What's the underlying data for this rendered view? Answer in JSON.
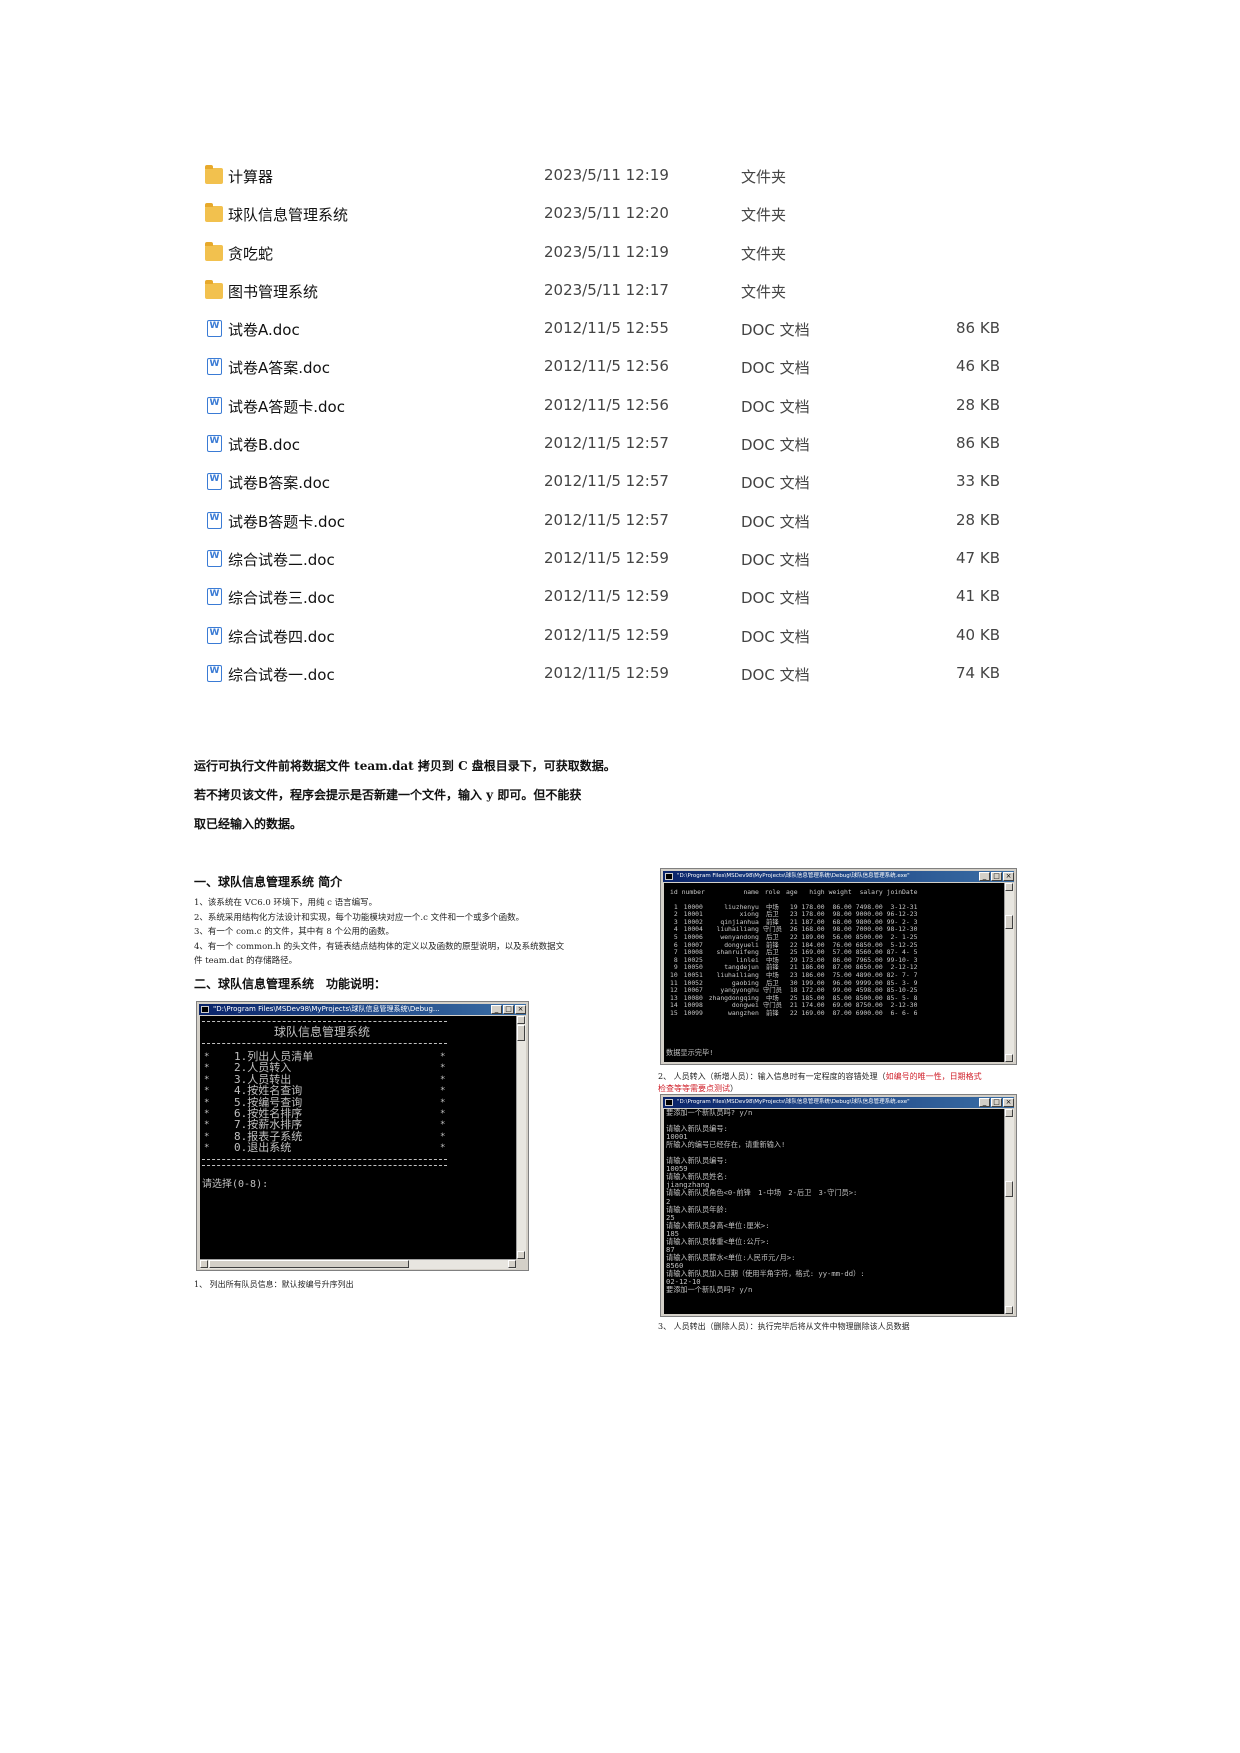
{
  "files": [
    {
      "name": "计算器",
      "date": "2023/5/11 12:19",
      "type": "文件夹",
      "size": "",
      "icon": "folder-icon"
    },
    {
      "name": "球队信息管理系统",
      "date": "2023/5/11 12:20",
      "type": "文件夹",
      "size": "",
      "icon": "folder-icon"
    },
    {
      "name": "贪吃蛇",
      "date": "2023/5/11 12:19",
      "type": "文件夹",
      "size": "",
      "icon": "folder-icon"
    },
    {
      "name": "图书管理系统",
      "date": "2023/5/11 12:17",
      "type": "文件夹",
      "size": "",
      "icon": "folder-icon"
    },
    {
      "name": "试卷A.doc",
      "date": "2012/11/5 12:55",
      "type": "DOC 文档",
      "size": "86 KB",
      "icon": "doc-icon"
    },
    {
      "name": "试卷A答案.doc",
      "date": "2012/11/5 12:56",
      "type": "DOC 文档",
      "size": "46 KB",
      "icon": "doc-icon"
    },
    {
      "name": "试卷A答题卡.doc",
      "date": "2012/11/5 12:56",
      "type": "DOC 文档",
      "size": "28 KB",
      "icon": "doc-icon"
    },
    {
      "name": "试卷B.doc",
      "date": "2012/11/5 12:57",
      "type": "DOC 文档",
      "size": "86 KB",
      "icon": "doc-icon"
    },
    {
      "name": "试卷B答案.doc",
      "date": "2012/11/5 12:57",
      "type": "DOC 文档",
      "size": "33 KB",
      "icon": "doc-icon"
    },
    {
      "name": "试卷B答题卡.doc",
      "date": "2012/11/5 12:57",
      "type": "DOC 文档",
      "size": "28 KB",
      "icon": "doc-icon"
    },
    {
      "name": "综合试卷二.doc",
      "date": "2012/11/5 12:59",
      "type": "DOC 文档",
      "size": "47 KB",
      "icon": "doc-icon"
    },
    {
      "name": "综合试卷三.doc",
      "date": "2012/11/5 12:59",
      "type": "DOC 文档",
      "size": "41 KB",
      "icon": "doc-icon"
    },
    {
      "name": "综合试卷四.doc",
      "date": "2012/11/5 12:59",
      "type": "DOC 文档",
      "size": "40 KB",
      "icon": "doc-icon"
    },
    {
      "name": "综合试卷一.doc",
      "date": "2012/11/5 12:59",
      "type": "DOC 文档",
      "size": "74 KB",
      "icon": "doc-icon"
    }
  ],
  "notes": [
    "运行可执行文件前将数据文件 team.dat 拷贝到 C 盘根目录下，可获取数据。",
    "若不拷贝该文件，程序会提示是否新建一个文件，输入 y 即可。但不能获",
    "取已经输入的数据。"
  ],
  "section1_title": "一、球队信息管理系统 简介",
  "section1_items": [
    "1、该系统在 VC6.0 环境下，用纯 c 语言编写。",
    "2、系统采用结构化方法设计和实现，每个功能模块对应一个.c 文件和一个或多个函数。",
    "3、有一个 com.c 的文件，其中有 8 个公用的函数。",
    "4、有一个 common.h 的头文件，有链表结点结构体的定义以及函数的原型说明，以及系统数据文",
    "件 team.dat 的存储路径。"
  ],
  "section2_title": "二、球队信息管理系统　功能说明：",
  "menu_window": {
    "title": "\"D:\\Program Files\\MSDev98\\MyProjects\\球队信息管理系统\\Debug...",
    "heading": "球队信息管理系统",
    "items": [
      "1.列出人员清单",
      "2.人员转入",
      "3.人员转出",
      "4.按姓名查询",
      "5.按编号查询",
      "6.按姓名排序",
      "7.按薪水排序",
      "8.报表子系统",
      "0.退出系统"
    ],
    "prompt": "请选择(0-8):"
  },
  "caption1": "1、 列出所有队员信息：默认按编号升序列出",
  "table_window": {
    "title": "\"D:\\Program Files\\MSDev98\\MyProjects\\球队信息管理系统\\Debug\\球队信息管理系统.exe\"",
    "headers": [
      "id",
      "number",
      "name",
      "role",
      "age",
      "high",
      "weight",
      "salary",
      "joinDate"
    ],
    "rows": [
      [
        "1",
        "10000",
        "liuzhenyu",
        "中场",
        "19",
        "178.00",
        "86.00",
        "7498.00",
        "3-12-31"
      ],
      [
        "2",
        "10001",
        "xiong",
        "后卫",
        "23",
        "178.00",
        "98.00",
        "9000.00",
        "96-12-23"
      ],
      [
        "3",
        "10002",
        "qinjianhua",
        "前锋",
        "21",
        "187.00",
        "68.00",
        "9800.00",
        "99- 2- 3"
      ],
      [
        "4",
        "10004",
        "liuhailiang",
        "守门员",
        "26",
        "168.00",
        "98.00",
        "7000.00",
        "98-12-30"
      ],
      [
        "5",
        "10006",
        "wenyandong",
        "后卫",
        "22",
        "189.00",
        "56.00",
        "8500.00",
        "2- 1-25"
      ],
      [
        "6",
        "10007",
        "dongyueli",
        "前锋",
        "22",
        "184.00",
        "76.00",
        "6850.00",
        "5-12-25"
      ],
      [
        "7",
        "10008",
        "shanruifeng",
        "后卫",
        "25",
        "169.00",
        "57.00",
        "8560.00",
        "87- 4- 5"
      ],
      [
        "8",
        "10025",
        "linlei",
        "中场",
        "29",
        "173.00",
        "86.00",
        "7965.00",
        "99-10- 3"
      ],
      [
        "9",
        "10050",
        "tangdejun",
        "前锋",
        "21",
        "186.00",
        "87.00",
        "8650.00",
        "2-12-12"
      ],
      [
        "10",
        "10051",
        "liuhailiang",
        "中场",
        "23",
        "186.00",
        "75.00",
        "4890.00",
        "82- 7- 7"
      ],
      [
        "11",
        "10052",
        "gaobing",
        "后卫",
        "30",
        "199.00",
        "96.00",
        "9999.00",
        "85- 3- 9"
      ],
      [
        "12",
        "10067",
        "yangyonghu",
        "守门员",
        "18",
        "172.00",
        "99.00",
        "4598.00",
        "85-10-25"
      ],
      [
        "13",
        "10080",
        "zhangdongqing",
        "中场",
        "25",
        "185.00",
        "85.00",
        "8500.00",
        "85- 5- 8"
      ],
      [
        "14",
        "10098",
        "dongwei",
        "守门员",
        "21",
        "174.00",
        "69.00",
        "8750.00",
        "2-12-30"
      ],
      [
        "15",
        "10099",
        "wangzhen",
        "前锋",
        "22",
        "169.00",
        "87.00",
        "6900.00",
        "6- 6- 6"
      ]
    ],
    "footer": "数据显示完毕!"
  },
  "caption2_prefix": "2、 人员转入（新增人员）：输入信息时有一定程度的容错处理（",
  "caption2_red": "如编号的唯一性，日期格式检查等等需要点测试",
  "caption2_suffix": "）",
  "input_window": {
    "title": "\"D:\\Program Files\\MSDev98\\MyProjects\\球队信息管理系统\\Debug\\球队信息管理系统.exe\"",
    "lines": [
      "要添加一个新队员吗? y/n",
      "",
      "请输入新队员编号:",
      "10001",
      "所输入的编号已经存在，请重新输入!",
      "",
      "请输入新队员编号:",
      "10059",
      "请输入新队员姓名:",
      "jiangzhang",
      "请输入新队员角色<0-前锋　1-中场　2-后卫　3-守门员>:",
      "2",
      "请输入新队员年龄:",
      "25",
      "请输入新队员身高<单位:厘米>:",
      "185",
      "请输入新队员体重<单位:公斤>:",
      "87",
      "请输入新队员薪水<单位:人民币元/月>:",
      "8560",
      "请输入新队员加入日期（使用半角字符，格式: yy-mm-dd）:",
      "02-12-10",
      "要添加一个新队员吗? y/n"
    ]
  },
  "caption3": "3、 人员转出（删除人员）：执行完毕后将从文件中物理删除该人员数据",
  "titlebar_buttons": [
    "_",
    "□",
    "×"
  ]
}
